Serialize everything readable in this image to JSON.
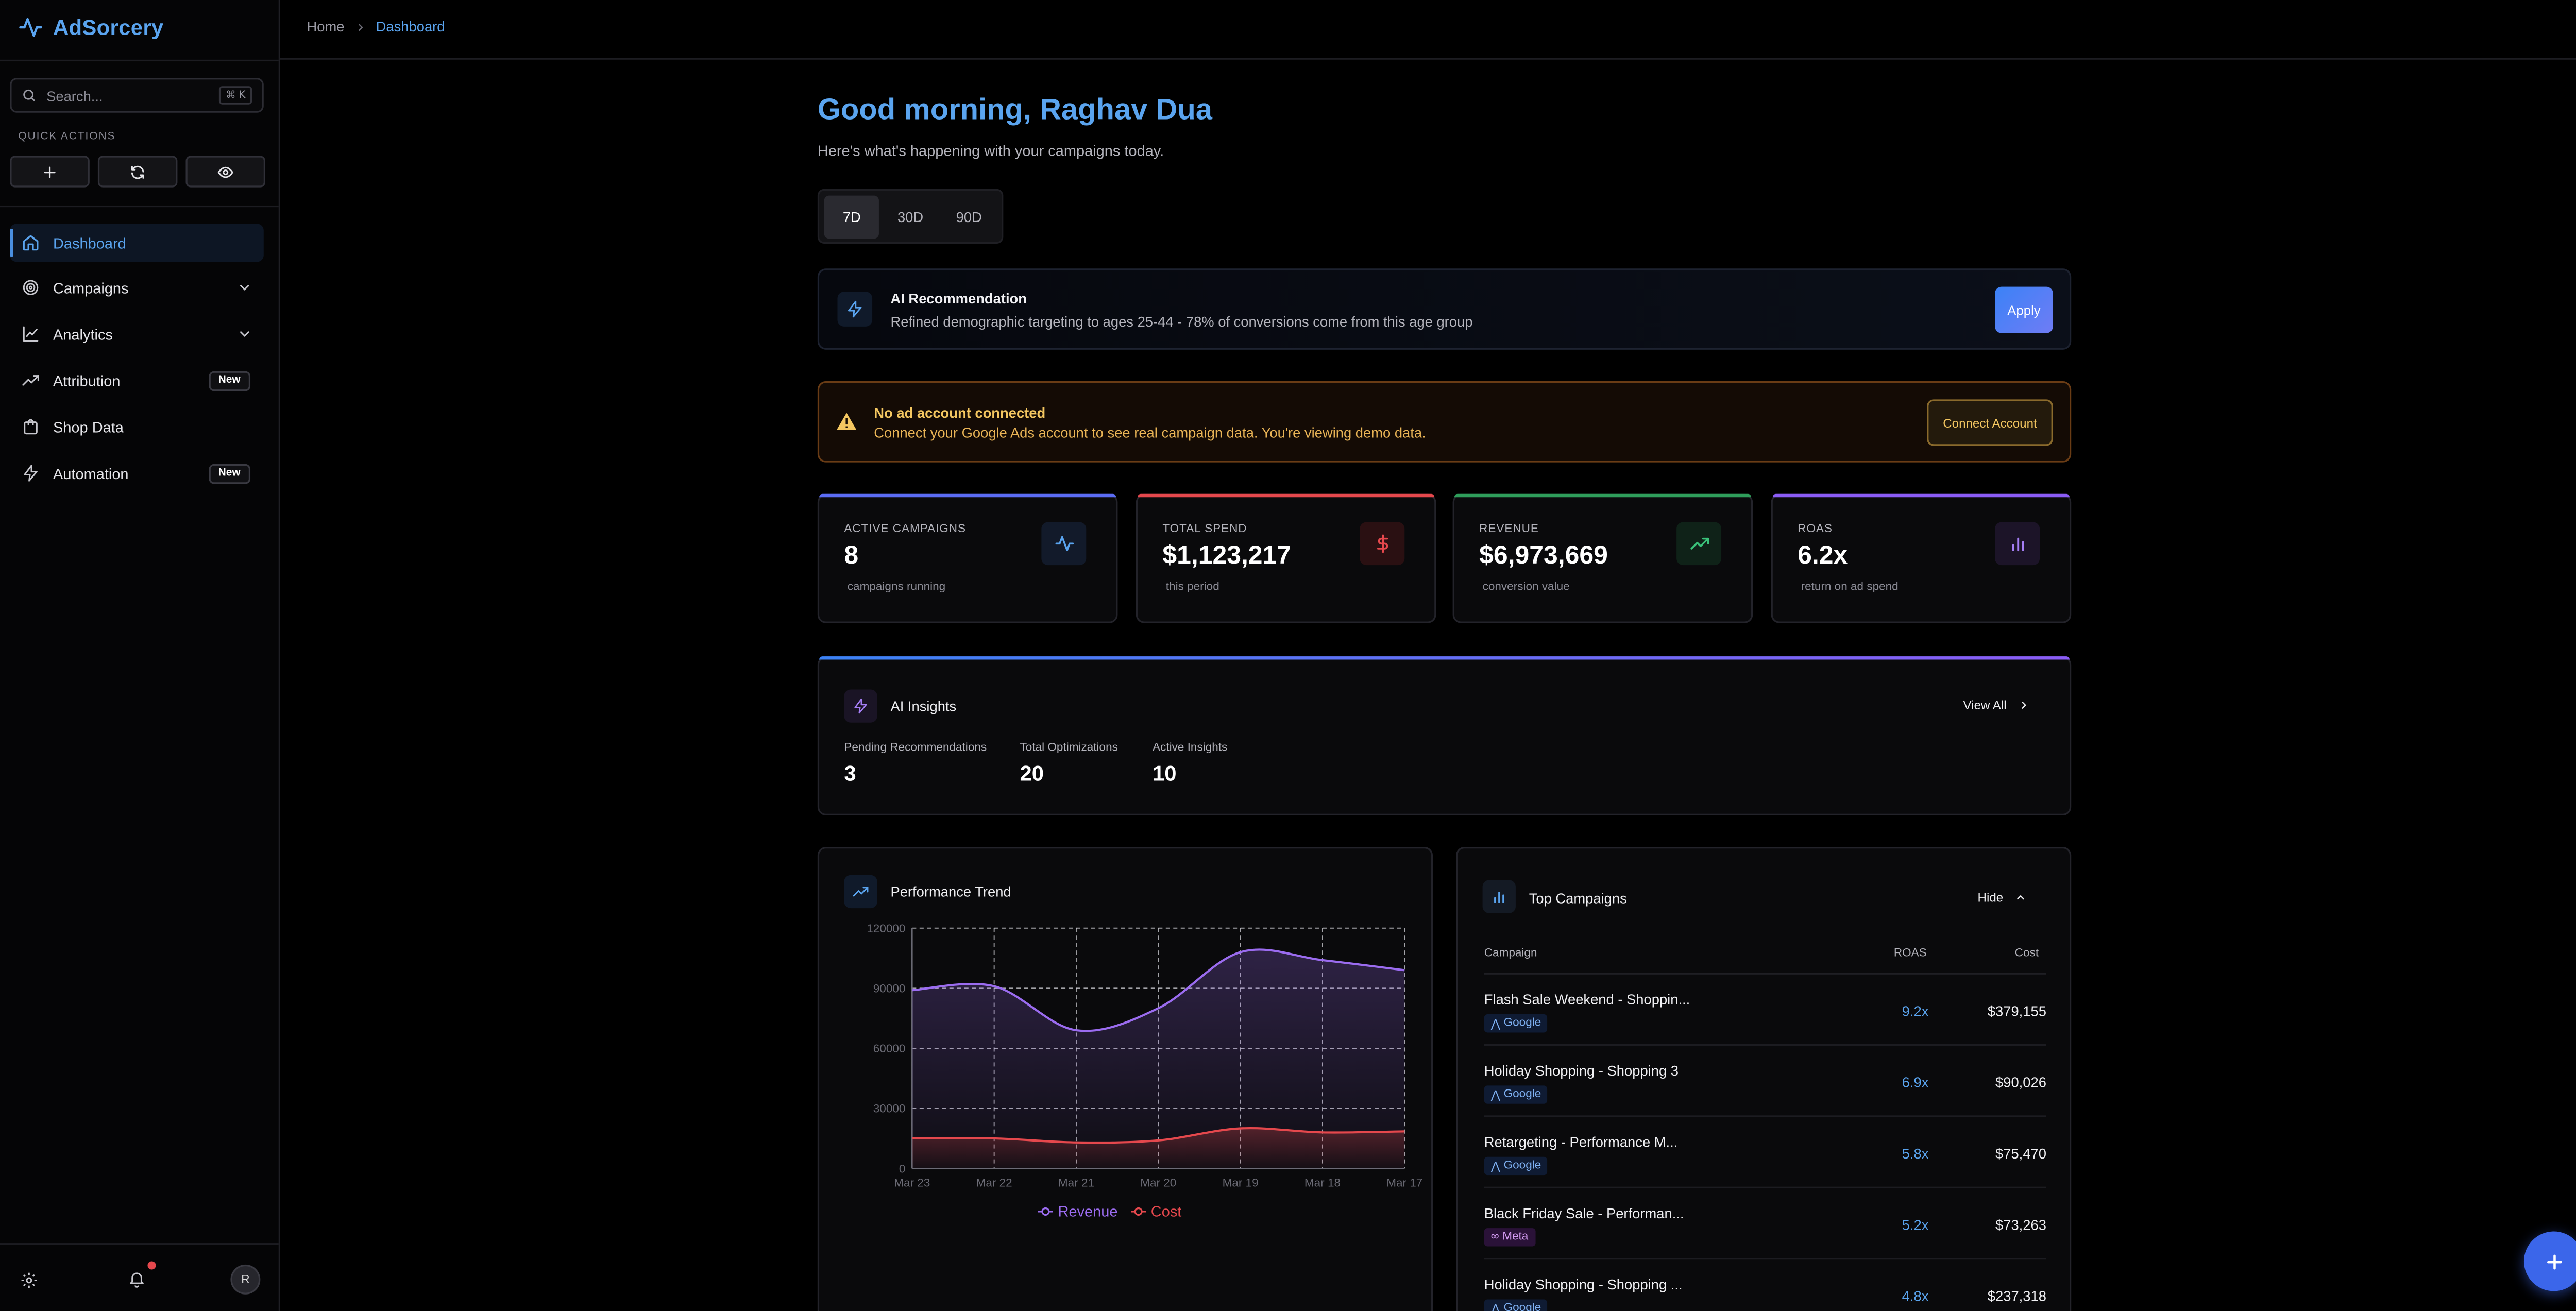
{
  "brand": {
    "name": "AdSorcery"
  },
  "search": {
    "placeholder": "Search...",
    "shortcut": "⌘ K"
  },
  "quick_actions": {
    "label": "QUICK ACTIONS"
  },
  "nav": [
    {
      "label": "Dashboard"
    },
    {
      "label": "Campaigns"
    },
    {
      "label": "Analytics"
    },
    {
      "label": "Attribution",
      "badge": "New"
    },
    {
      "label": "Shop Data"
    },
    {
      "label": "Automation",
      "badge": "New"
    }
  ],
  "user": {
    "initial": "R"
  },
  "breadcrumb": {
    "home": "Home",
    "current": "Dashboard"
  },
  "greeting": {
    "title": "Good morning, Raghav Dua",
    "subtitle": "Here's what's happening with your campaigns today."
  },
  "ranges": [
    "7D",
    "30D",
    "90D"
  ],
  "ai_recommendation": {
    "title": "AI Recommendation",
    "text": "Refined demographic targeting to ages 25-44 - 78% of conversions come from this age group",
    "button": "Apply"
  },
  "warning": {
    "title": "No ad account connected",
    "text": "Connect your Google Ads account to see real campaign data. You're viewing demo data.",
    "button": "Connect Account"
  },
  "stats": [
    {
      "label": "ACTIVE CAMPAIGNS",
      "value": "8",
      "sub": "campaigns running",
      "color": "#5b6cf5"
    },
    {
      "label": "TOTAL SPEND",
      "value": "$1,123,217",
      "sub": "this period",
      "color": "#e5484d"
    },
    {
      "label": "REVENUE",
      "value": "$6,973,669",
      "sub": "conversion value",
      "color": "#2f9e5b"
    },
    {
      "label": "ROAS",
      "value": "6.2x",
      "sub": "return on ad spend",
      "color": "#8b5cf6"
    }
  ],
  "insights": {
    "title": "AI Insights",
    "view_all": "View All",
    "metrics": [
      {
        "label": "Pending Recommendations",
        "value": "3"
      },
      {
        "label": "Total Optimizations",
        "value": "20"
      },
      {
        "label": "Active Insights",
        "value": "10"
      }
    ]
  },
  "performance": {
    "title": "Performance Trend"
  },
  "chart_data": {
    "type": "area",
    "x": [
      "Mar 23",
      "Mar 22",
      "Mar 21",
      "Mar 20",
      "Mar 19",
      "Mar 18",
      "Mar 17"
    ],
    "ylim": [
      0,
      120000
    ],
    "yticks": [
      0,
      30000,
      60000,
      90000,
      120000
    ],
    "grid": true,
    "legend": "bottom",
    "series": [
      {
        "name": "Revenue",
        "color": "#9b6cf0",
        "values": [
          89000,
          91000,
          69000,
          80000,
          108000,
          104000,
          99000
        ]
      },
      {
        "name": "Cost",
        "color": "#e5484d",
        "values": [
          15000,
          15000,
          13000,
          14000,
          20000,
          18000,
          18500
        ]
      }
    ]
  },
  "top_campaigns": {
    "title": "Top Campaigns",
    "hide": "Hide",
    "columns": [
      "Campaign",
      "ROAS",
      "Cost"
    ],
    "rows": [
      {
        "name": "Flash Sale Weekend - Shoppin...",
        "platform": "Google",
        "roas": "9.2x",
        "cost": "$379,155"
      },
      {
        "name": "Holiday Shopping - Shopping 3",
        "platform": "Google",
        "roas": "6.9x",
        "cost": "$90,026"
      },
      {
        "name": "Retargeting - Performance M...",
        "platform": "Google",
        "roas": "5.8x",
        "cost": "$75,470"
      },
      {
        "name": "Black Friday Sale - Performan...",
        "platform": "Meta",
        "roas": "5.2x",
        "cost": "$73,263"
      },
      {
        "name": "Holiday Shopping - Shopping ...",
        "platform": "Google",
        "roas": "4.8x",
        "cost": "$237,318"
      }
    ]
  }
}
